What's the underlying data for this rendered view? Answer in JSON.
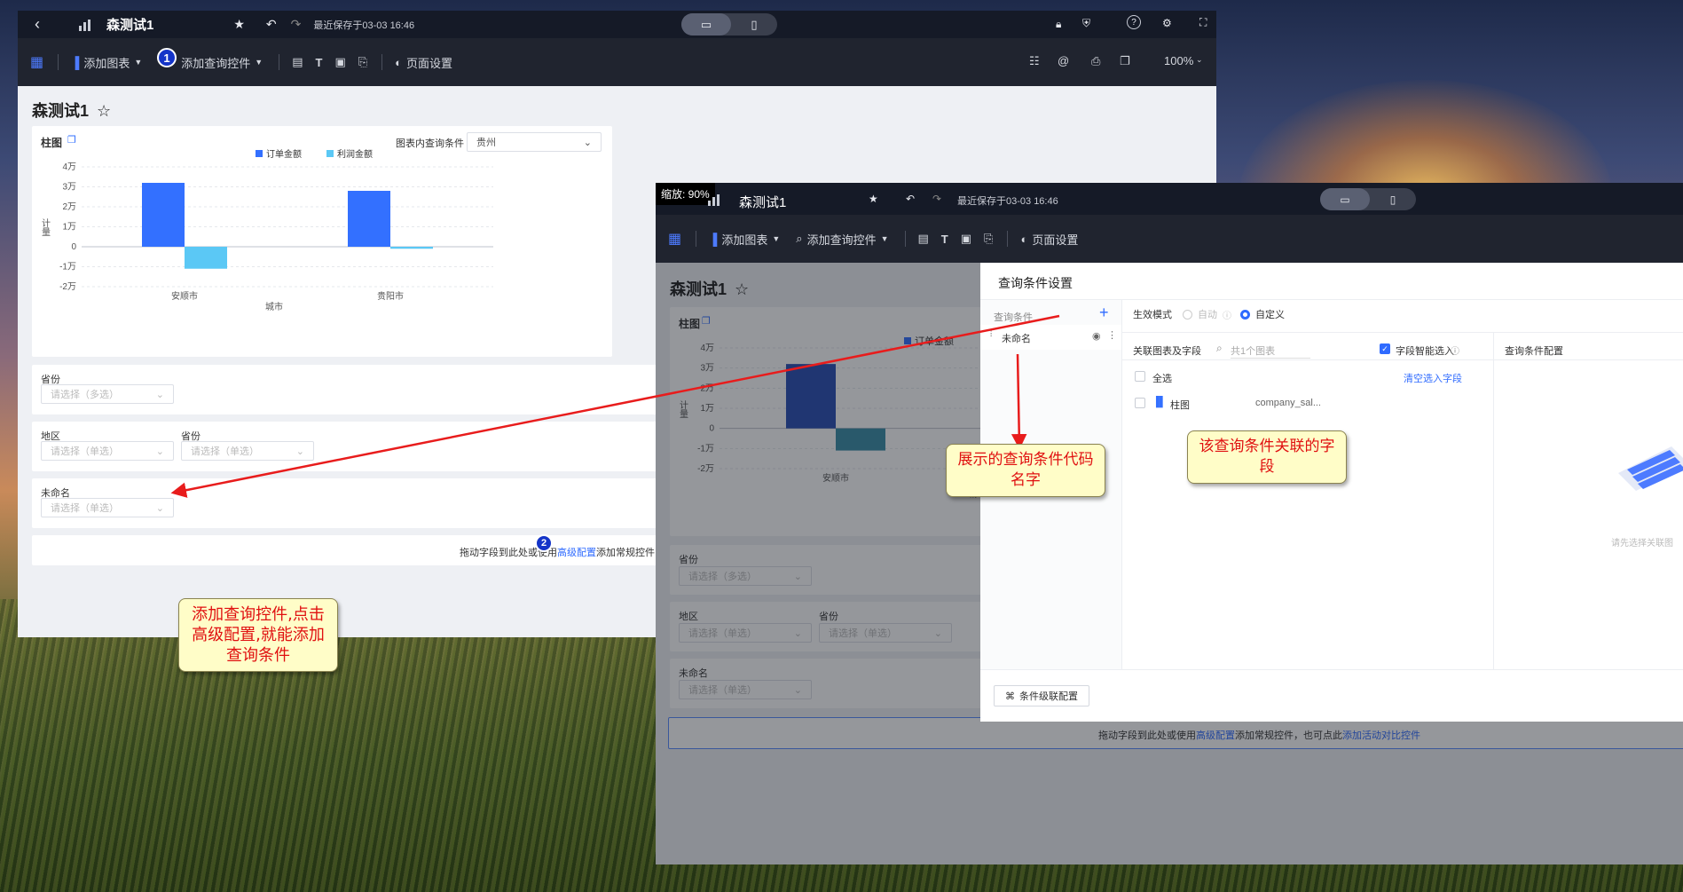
{
  "colors": {
    "order_bar": "#3370ff",
    "profit_bar": "#5bc8f5",
    "accent": "#2f6bff",
    "annotation_text": "#e01010",
    "arrow": "#e81c1c"
  },
  "left_window": {
    "title": "森测试1",
    "last_saved": "最近保存于03-03 16:46",
    "toolbar": {
      "add_chart": "添加图表",
      "add_query": "添加查询控件",
      "page_settings": "页面设置",
      "zoom": "100%"
    },
    "page_title": "森测试1",
    "chart_card": {
      "title": "柱图",
      "filter_label": "图表内查询条件",
      "filter_value": "贵州",
      "ylabel": "计量",
      "xlabel": "城市",
      "legend": [
        "订单金额",
        "利润金额"
      ],
      "yticks": [
        "4万",
        "3万",
        "2万",
        "1万",
        "0",
        "-1万",
        "-2万"
      ]
    },
    "filters": {
      "province_label": "省份",
      "province_placeholder": "请选择（多选）",
      "region_label": "地区",
      "region_placeholder": "请选择（单选）",
      "province2_label": "省份",
      "province2_placeholder": "请选择（单选）",
      "unnamed_label": "未命名",
      "unnamed_placeholder": "请选择（单选）"
    },
    "dropzone": {
      "prefix": "拖动字段到此处或使用",
      "link": "高级配置",
      "suffix": "添加常规控件，"
    },
    "badge1": "1",
    "badge2": "2"
  },
  "chart_data": {
    "type": "bar",
    "title": "柱图",
    "categories": [
      "安顺市",
      "贵阳市"
    ],
    "series": [
      {
        "name": "订单金额",
        "values": [
          32000,
          28000
        ]
      },
      {
        "name": "利润金额",
        "values": [
          -11000,
          -1000
        ]
      }
    ],
    "xlabel": "城市",
    "ylabel": "计量",
    "ylim": [
      -20000,
      40000
    ],
    "yticks": [
      "4万",
      "3万",
      "2万",
      "1万",
      "0",
      "-1万",
      "-2万"
    ],
    "legend_position": "top",
    "grid": true
  },
  "right_window": {
    "zoom_badge": "缩放: 90%",
    "title": "森测试1",
    "last_saved": "最近保存于03-03 16:46",
    "toolbar": {
      "add_chart": "添加图表",
      "add_query": "添加查询控件",
      "page_settings": "页面设置"
    },
    "page_title": "森测试1",
    "chart_title": "柱图",
    "legend_first": "订单金额",
    "yticks": [
      "4万",
      "3万",
      "2万",
      "1万",
      "0",
      "-1万",
      "-2万"
    ],
    "ylabel": "计量",
    "category": "安顺市",
    "xlabel_partial": "城市",
    "filters": {
      "province_label": "省份",
      "province_placeholder": "请选择（多选）",
      "region_label": "地区",
      "region_placeholder": "请选择（单选）",
      "province2_label": "省份",
      "province2_placeholder": "请选择（单选）",
      "unnamed_label": "未命名",
      "unnamed_placeholder": "请选择（单选）"
    },
    "dropzone": {
      "prefix": "拖动字段到此处或使用",
      "link1": "高级配置",
      "middle": "添加常规控件，也可点此",
      "link2": "添加活动对比控件"
    }
  },
  "dialog": {
    "title": "查询条件设置",
    "section_label": "查询条件",
    "item_name": "未命名",
    "mode_label": "生效模式",
    "mode_auto": "自动",
    "mode_custom": "自定义",
    "assoc_label": "关联图表及字段",
    "search_placeholder": "共1个图表",
    "smart_select": "字段智能选入",
    "config_label": "查询条件配置",
    "select_all": "全选",
    "clear_link": "清空选入字段",
    "chart_item": "柱图",
    "field_value": "company_sal...",
    "empty_hint": "请先选择关联图",
    "cascade_button": "条件级联配置"
  },
  "annotations": {
    "add_query_note": "添加查询控件,点击高级配置,就能添加查询条件",
    "code_name_note": "展示的查询条件代码名字",
    "field_note": "该查询条件关联的字段"
  }
}
